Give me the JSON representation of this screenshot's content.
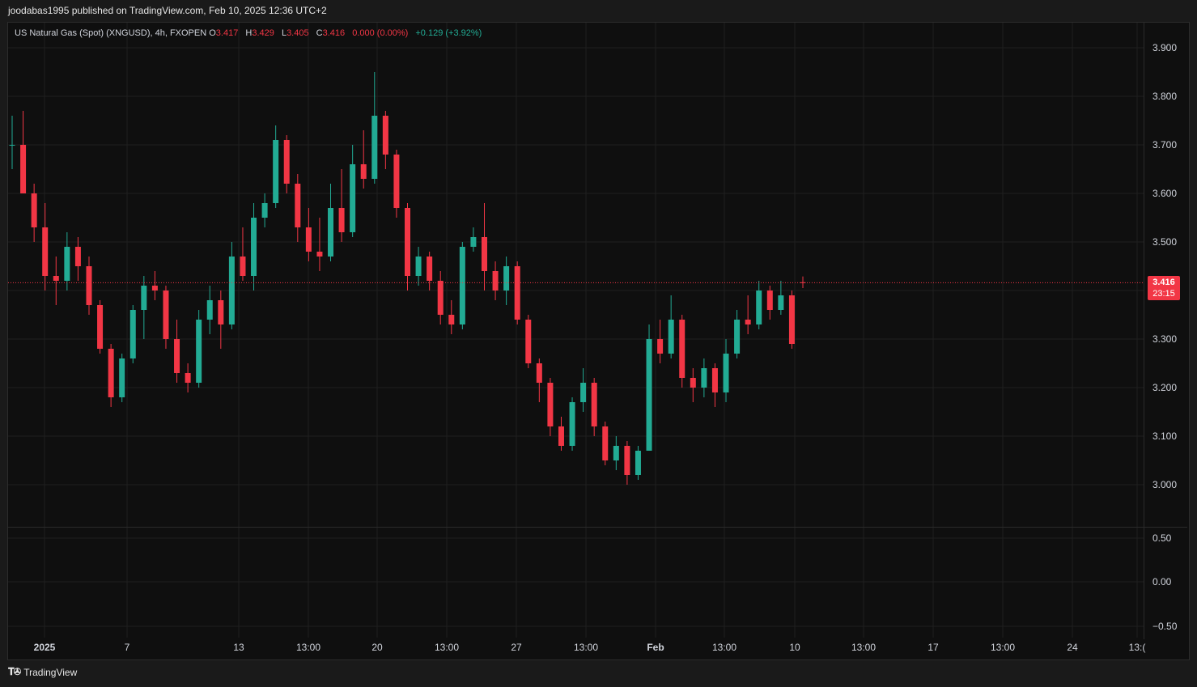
{
  "header": {
    "publisher_line": "joodabas1995 published on TradingView.com, Feb 10, 2025 12:36 UTC+2"
  },
  "legend": {
    "symbol": "US Natural Gas (Spot) (XNGUSD), 4h, FXOPEN",
    "o_label": "O",
    "o_value": "3.417",
    "h_label": "H",
    "h_value": "3.429",
    "l_label": "L",
    "l_value": "3.405",
    "c_label": "C",
    "c_value": "3.416",
    "change": "0.000 (0.00%)",
    "change2": "+0.129 (+3.92%)"
  },
  "price_badge": {
    "price": "3.416",
    "countdown": "23:15"
  },
  "footer": {
    "brand": "TradingView"
  },
  "colors": {
    "up": "#22ab94",
    "down": "#f23645",
    "background": "#0f0f0f",
    "grid": "#1f1f1f"
  },
  "chart_data": {
    "type": "candlestick",
    "title": "US Natural Gas (Spot) (XNGUSD), 4h, FXOPEN",
    "price_axis": {
      "ticks": [
        "3.900",
        "3.800",
        "3.700",
        "3.600",
        "3.500",
        "3.400",
        "3.300",
        "3.200",
        "3.100",
        "3.000"
      ],
      "ylim": [
        2.91,
        3.98
      ]
    },
    "indicator_axis": {
      "ticks": [
        "0.50",
        "0.00",
        "−0.50"
      ]
    },
    "time_axis": {
      "ticks": [
        "2025",
        "7",
        "13",
        "13:00",
        "20",
        "13:00",
        "27",
        "13:00",
        "Feb",
        "13:00",
        "10",
        "13:00",
        "17",
        "13:00",
        "24",
        "13:("
      ]
    },
    "last_price": 3.416,
    "grid": true,
    "series": [
      {
        "o": 3.7,
        "h": 3.76,
        "l": 3.65,
        "c": 3.7
      },
      {
        "o": 3.7,
        "h": 3.77,
        "l": 3.63,
        "c": 3.6
      },
      {
        "o": 3.6,
        "h": 3.62,
        "l": 3.5,
        "c": 3.53
      },
      {
        "o": 3.53,
        "h": 3.58,
        "l": 3.4,
        "c": 3.43
      },
      {
        "o": 3.43,
        "h": 3.47,
        "l": 3.37,
        "c": 3.42
      },
      {
        "o": 3.42,
        "h": 3.52,
        "l": 3.4,
        "c": 3.49
      },
      {
        "o": 3.49,
        "h": 3.51,
        "l": 3.42,
        "c": 3.45
      },
      {
        "o": 3.45,
        "h": 3.47,
        "l": 3.35,
        "c": 3.37
      },
      {
        "o": 3.37,
        "h": 3.38,
        "l": 3.27,
        "c": 3.28
      },
      {
        "o": 3.28,
        "h": 3.29,
        "l": 3.16,
        "c": 3.18
      },
      {
        "o": 3.18,
        "h": 3.27,
        "l": 3.17,
        "c": 3.26
      },
      {
        "o": 3.26,
        "h": 3.37,
        "l": 3.25,
        "c": 3.36
      },
      {
        "o": 3.36,
        "h": 3.43,
        "l": 3.3,
        "c": 3.41
      },
      {
        "o": 3.41,
        "h": 3.44,
        "l": 3.38,
        "c": 3.4
      },
      {
        "o": 3.4,
        "h": 3.41,
        "l": 3.28,
        "c": 3.3
      },
      {
        "o": 3.3,
        "h": 3.34,
        "l": 3.21,
        "c": 3.23
      },
      {
        "o": 3.23,
        "h": 3.25,
        "l": 3.19,
        "c": 3.21
      },
      {
        "o": 3.21,
        "h": 3.36,
        "l": 3.2,
        "c": 3.34
      },
      {
        "o": 3.34,
        "h": 3.41,
        "l": 3.31,
        "c": 3.38
      },
      {
        "o": 3.38,
        "h": 3.4,
        "l": 3.28,
        "c": 3.33
      },
      {
        "o": 3.33,
        "h": 3.5,
        "l": 3.32,
        "c": 3.47
      },
      {
        "o": 3.47,
        "h": 3.53,
        "l": 3.42,
        "c": 3.43
      },
      {
        "o": 3.43,
        "h": 3.58,
        "l": 3.4,
        "c": 3.55
      },
      {
        "o": 3.55,
        "h": 3.6,
        "l": 3.53,
        "c": 3.58
      },
      {
        "o": 3.58,
        "h": 3.74,
        "l": 3.57,
        "c": 3.71
      },
      {
        "o": 3.71,
        "h": 3.72,
        "l": 3.6,
        "c": 3.62
      },
      {
        "o": 3.62,
        "h": 3.64,
        "l": 3.5,
        "c": 3.53
      },
      {
        "o": 3.53,
        "h": 3.57,
        "l": 3.46,
        "c": 3.48
      },
      {
        "o": 3.48,
        "h": 3.55,
        "l": 3.44,
        "c": 3.47
      },
      {
        "o": 3.47,
        "h": 3.62,
        "l": 3.46,
        "c": 3.57
      },
      {
        "o": 3.57,
        "h": 3.65,
        "l": 3.5,
        "c": 3.52
      },
      {
        "o": 3.52,
        "h": 3.7,
        "l": 3.51,
        "c": 3.66
      },
      {
        "o": 3.66,
        "h": 3.73,
        "l": 3.61,
        "c": 3.63
      },
      {
        "o": 3.63,
        "h": 3.85,
        "l": 3.62,
        "c": 3.76
      },
      {
        "o": 3.76,
        "h": 3.77,
        "l": 3.65,
        "c": 3.68
      },
      {
        "o": 3.68,
        "h": 3.69,
        "l": 3.55,
        "c": 3.57
      },
      {
        "o": 3.57,
        "h": 3.58,
        "l": 3.4,
        "c": 3.43
      },
      {
        "o": 3.43,
        "h": 3.49,
        "l": 3.41,
        "c": 3.47
      },
      {
        "o": 3.47,
        "h": 3.48,
        "l": 3.4,
        "c": 3.42
      },
      {
        "o": 3.42,
        "h": 3.44,
        "l": 3.33,
        "c": 3.35
      },
      {
        "o": 3.35,
        "h": 3.38,
        "l": 3.31,
        "c": 3.33
      },
      {
        "o": 3.33,
        "h": 3.5,
        "l": 3.32,
        "c": 3.49
      },
      {
        "o": 3.49,
        "h": 3.53,
        "l": 3.48,
        "c": 3.51
      },
      {
        "o": 3.51,
        "h": 3.58,
        "l": 3.4,
        "c": 3.44
      },
      {
        "o": 3.44,
        "h": 3.46,
        "l": 3.38,
        "c": 3.4
      },
      {
        "o": 3.4,
        "h": 3.47,
        "l": 3.37,
        "c": 3.45
      },
      {
        "o": 3.45,
        "h": 3.46,
        "l": 3.33,
        "c": 3.34
      },
      {
        "o": 3.34,
        "h": 3.35,
        "l": 3.24,
        "c": 3.25
      },
      {
        "o": 3.25,
        "h": 3.26,
        "l": 3.17,
        "c": 3.21
      },
      {
        "o": 3.21,
        "h": 3.22,
        "l": 3.1,
        "c": 3.12
      },
      {
        "o": 3.12,
        "h": 3.14,
        "l": 3.07,
        "c": 3.08
      },
      {
        "o": 3.08,
        "h": 3.18,
        "l": 3.07,
        "c": 3.17
      },
      {
        "o": 3.17,
        "h": 3.24,
        "l": 3.15,
        "c": 3.21
      },
      {
        "o": 3.21,
        "h": 3.22,
        "l": 3.1,
        "c": 3.12
      },
      {
        "o": 3.12,
        "h": 3.13,
        "l": 3.04,
        "c": 3.05
      },
      {
        "o": 3.05,
        "h": 3.1,
        "l": 3.03,
        "c": 3.08
      },
      {
        "o": 3.08,
        "h": 3.09,
        "l": 3.0,
        "c": 3.02
      },
      {
        "o": 3.02,
        "h": 3.08,
        "l": 3.01,
        "c": 3.07
      },
      {
        "o": 3.07,
        "h": 3.33,
        "l": 3.07,
        "c": 3.3
      },
      {
        "o": 3.3,
        "h": 3.34,
        "l": 3.25,
        "c": 3.27
      },
      {
        "o": 3.27,
        "h": 3.39,
        "l": 3.26,
        "c": 3.34
      },
      {
        "o": 3.34,
        "h": 3.35,
        "l": 3.2,
        "c": 3.22
      },
      {
        "o": 3.22,
        "h": 3.24,
        "l": 3.17,
        "c": 3.2
      },
      {
        "o": 3.2,
        "h": 3.26,
        "l": 3.18,
        "c": 3.24
      },
      {
        "o": 3.24,
        "h": 3.25,
        "l": 3.16,
        "c": 3.19
      },
      {
        "o": 3.19,
        "h": 3.3,
        "l": 3.17,
        "c": 3.27
      },
      {
        "o": 3.27,
        "h": 3.36,
        "l": 3.26,
        "c": 3.34
      },
      {
        "o": 3.34,
        "h": 3.39,
        "l": 3.31,
        "c": 3.33
      },
      {
        "o": 3.33,
        "h": 3.42,
        "l": 3.32,
        "c": 3.4
      },
      {
        "o": 3.4,
        "h": 3.41,
        "l": 3.34,
        "c": 3.36
      },
      {
        "o": 3.36,
        "h": 3.42,
        "l": 3.35,
        "c": 3.39
      },
      {
        "o": 3.39,
        "h": 3.4,
        "l": 3.28,
        "c": 3.29
      },
      {
        "o": 3.417,
        "h": 3.429,
        "l": 3.405,
        "c": 3.416
      }
    ]
  }
}
